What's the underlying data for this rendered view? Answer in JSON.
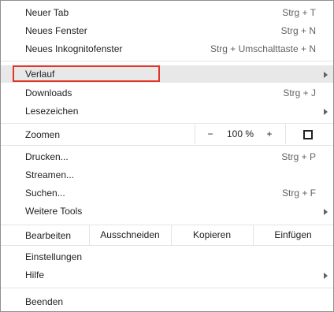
{
  "menu": {
    "new_tab": {
      "label": "Neuer Tab",
      "shortcut": "Strg + T"
    },
    "new_window": {
      "label": "Neues Fenster",
      "shortcut": "Strg + N"
    },
    "new_incognito": {
      "label": "Neues Inkognitofenster",
      "shortcut": "Strg + Umschalttaste + N"
    },
    "history": {
      "label": "Verlauf"
    },
    "downloads": {
      "label": "Downloads",
      "shortcut": "Strg + J"
    },
    "bookmarks": {
      "label": "Lesezeichen"
    },
    "zoom": {
      "label": "Zoomen",
      "minus": "−",
      "value": "100 %",
      "plus": "+"
    },
    "print": {
      "label": "Drucken...",
      "shortcut": "Strg + P"
    },
    "cast": {
      "label": "Streamen..."
    },
    "find": {
      "label": "Suchen...",
      "shortcut": "Strg + F"
    },
    "more_tools": {
      "label": "Weitere Tools"
    },
    "edit": {
      "label": "Bearbeiten",
      "cut": "Ausschneiden",
      "copy": "Kopieren",
      "paste": "Einfügen"
    },
    "settings": {
      "label": "Einstellungen"
    },
    "help": {
      "label": "Hilfe"
    },
    "exit": {
      "label": "Beenden"
    }
  },
  "colors": {
    "highlight_border": "#e0352b",
    "hover_bg": "#e8e8e8"
  }
}
